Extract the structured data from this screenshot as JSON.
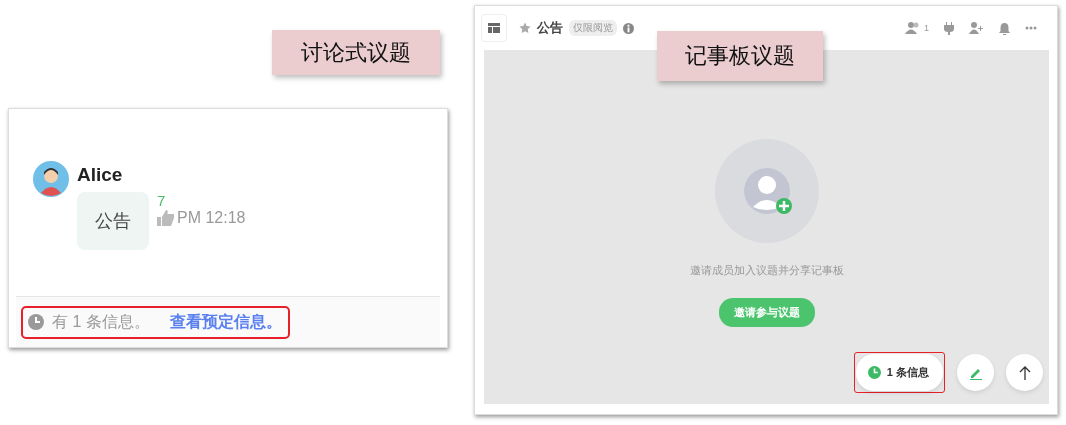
{
  "discussion_panel": {
    "label": "讨论式议题",
    "message": {
      "author": "Alice",
      "text": "公告",
      "count": "7",
      "time": "PM 12:18"
    },
    "notice": {
      "text": "有 1 条信息。",
      "link": "查看预定信息。",
      "highlighted": true
    }
  },
  "board_panel": {
    "label": "记事板议题",
    "header": {
      "title": "公告",
      "badge": "仅限阅览",
      "member_count": "1",
      "starred": false
    },
    "empty_state": {
      "text": "邀请成员加入议题并分享记事板",
      "button": "邀请参与议题"
    },
    "scheduled_button": {
      "text": "1 条信息",
      "highlighted": true
    }
  }
}
